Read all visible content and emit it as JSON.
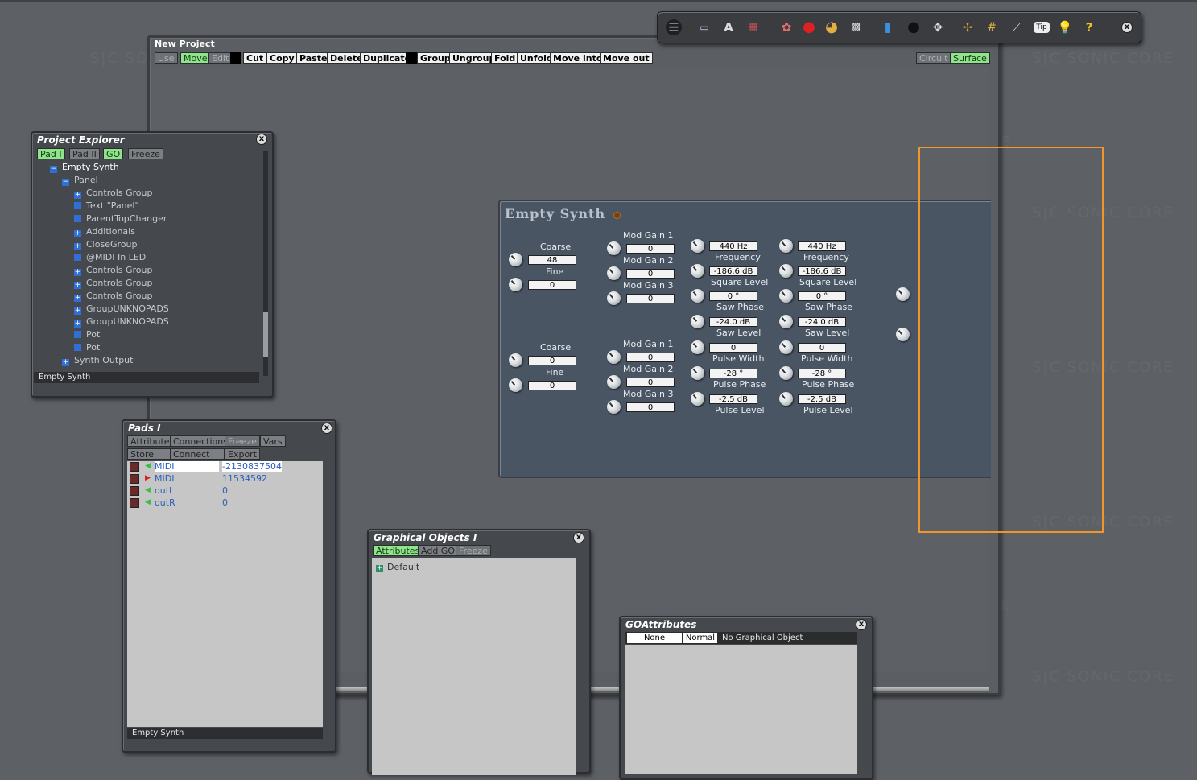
{
  "watermark": "S|C SONIC CORE",
  "project": {
    "title": "New Project",
    "modes": [
      "Use",
      "Move",
      "Edit"
    ],
    "edit_buttons": [
      "Cut",
      "Copy",
      "Paste",
      "Delete",
      "Duplicate"
    ],
    "group_buttons": [
      "Group",
      "Ungroup",
      "Fold",
      "Unfold",
      "Move into",
      "Move out"
    ],
    "view_tabs": [
      "Circuit",
      "Surface"
    ]
  },
  "synth": {
    "title": "Empty Synth",
    "osc1": {
      "coarse_label": "Coarse",
      "coarse": "48",
      "fine_label": "Fine",
      "fine": "0"
    },
    "osc2": {
      "coarse_label": "Coarse",
      "coarse": "0",
      "fine_label": "Fine",
      "fine": "0"
    },
    "mod1": [
      {
        "label": "Mod Gain 1",
        "value": "0"
      },
      {
        "label": "Mod Gain 2",
        "value": "0"
      },
      {
        "label": "Mod Gain 3",
        "value": "0"
      }
    ],
    "mod2": [
      {
        "label": "Mod Gain 1",
        "value": "0"
      },
      {
        "label": "Mod Gain 2",
        "value": "0"
      },
      {
        "label": "Mod Gain 3",
        "value": "0"
      }
    ],
    "colA": [
      {
        "label": "Frequency",
        "value": "440 Hz"
      },
      {
        "label": "Square Level",
        "value": "-186.6 dB"
      },
      {
        "label": "Saw Phase",
        "value": "0 °"
      },
      {
        "label": "Saw Level",
        "value": "-24.0 dB"
      },
      {
        "label": "Pulse Width",
        "value": "0"
      },
      {
        "label": "Pulse Phase",
        "value": "-28 °"
      },
      {
        "label": "Pulse Level",
        "value": "-2.5 dB"
      }
    ],
    "colB": [
      {
        "label": "Frequency",
        "value": "440 Hz"
      },
      {
        "label": "Square Level",
        "value": "-186.6 dB"
      },
      {
        "label": "Saw Phase",
        "value": "0 °"
      },
      {
        "label": "Saw Level",
        "value": "-24.0 dB"
      },
      {
        "label": "Pulse Width",
        "value": "0"
      },
      {
        "label": "Pulse Phase",
        "value": "-28 °"
      },
      {
        "label": "Pulse Level",
        "value": "-2.5 dB"
      }
    ]
  },
  "explorer": {
    "title": "Project Explorer",
    "tabs": [
      "Pad I",
      "Pad II",
      "GO",
      "Freeze"
    ],
    "tree": [
      {
        "label": "Empty Synth",
        "kind": "minus",
        "indent": 0
      },
      {
        "label": "Panel",
        "kind": "minus",
        "indent": 1
      },
      {
        "label": "Controls Group",
        "kind": "plus",
        "indent": 2
      },
      {
        "label": "Text \"Panel\"",
        "kind": "box",
        "indent": 2
      },
      {
        "label": "ParentTopChanger",
        "kind": "box",
        "indent": 2
      },
      {
        "label": "Additionals",
        "kind": "plus",
        "indent": 2
      },
      {
        "label": "CloseGroup",
        "kind": "plus",
        "indent": 2
      },
      {
        "label": "@MIDI In LED",
        "kind": "box",
        "indent": 2
      },
      {
        "label": "Controls Group",
        "kind": "plus",
        "indent": 2
      },
      {
        "label": "Controls Group",
        "kind": "plus",
        "indent": 2
      },
      {
        "label": "Controls Group",
        "kind": "plus",
        "indent": 2
      },
      {
        "label": "GroupUNKNOPADS",
        "kind": "plus",
        "indent": 2
      },
      {
        "label": "GroupUNKNOPADS",
        "kind": "plus",
        "indent": 2
      },
      {
        "label": "Pot",
        "kind": "box",
        "indent": 2
      },
      {
        "label": "Pot",
        "kind": "box",
        "indent": 2
      },
      {
        "label": "Synth Output",
        "kind": "plus",
        "indent": 1
      }
    ],
    "status": "Empty Synth"
  },
  "pads": {
    "title": "Pads I",
    "tabs_row1": [
      "Attributes",
      "Connections",
      "Freeze",
      "Vars"
    ],
    "tabs_row2": [
      "Store",
      "Connect",
      "Export"
    ],
    "rows": [
      {
        "name": "MIDI",
        "value": "-2130837504"
      },
      {
        "name": "MIDI",
        "value": "11534592"
      },
      {
        "name": "outL",
        "value": "0"
      },
      {
        "name": "outR",
        "value": "0"
      }
    ],
    "status": "Empty Synth"
  },
  "gobj": {
    "title": "Graphical Objects I",
    "tabs": [
      "Attributes",
      "Add GO",
      "Freeze"
    ],
    "items": [
      "Default"
    ]
  },
  "goattr": {
    "title": "GOAttributes",
    "none_label": "None",
    "normal_label": "Normal",
    "info": "No Graphical Object"
  },
  "toolbar": {
    "tip_label": "Tip",
    "help_label": "?",
    "text_tool_label": "A"
  },
  "colors": {
    "accent_green": "#8fe38a",
    "selection_orange": "#f0962a",
    "synth_panel": "#4a5563"
  }
}
